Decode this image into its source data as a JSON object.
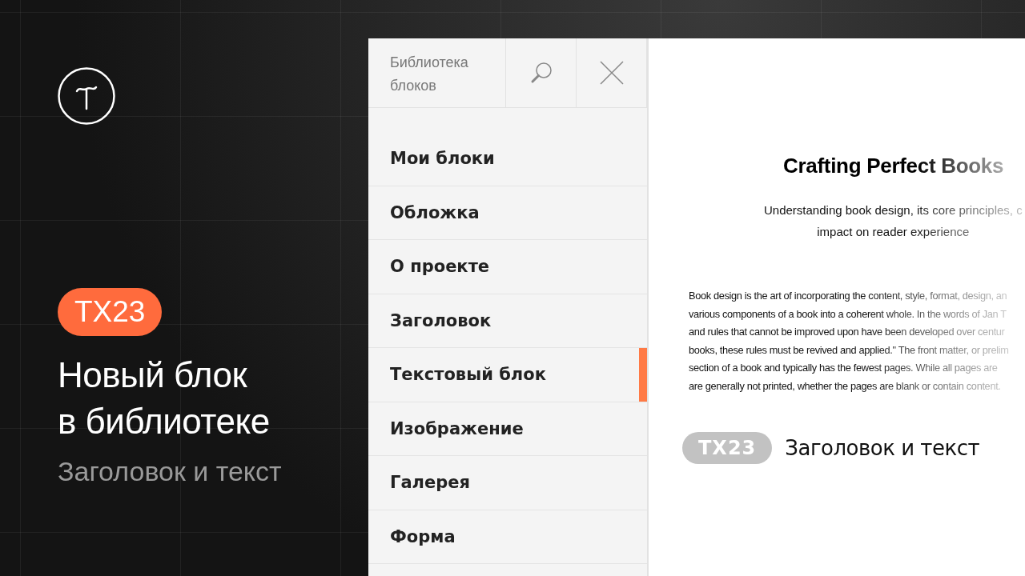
{
  "promo": {
    "badge": "TX23",
    "title_lines": [
      "Новый блок",
      "в библиотеке"
    ],
    "subtitle": "Заголовок и текст"
  },
  "library": {
    "title": "Библиотека блоков",
    "categories": [
      {
        "label": "Мои блоки",
        "selected": false
      },
      {
        "label": "Обложка",
        "selected": false
      },
      {
        "label": "О проекте",
        "selected": false
      },
      {
        "label": "Заголовок",
        "selected": false
      },
      {
        "label": "Текстовый блок",
        "selected": true
      },
      {
        "label": "Изображение",
        "selected": false
      },
      {
        "label": "Галерея",
        "selected": false
      },
      {
        "label": "Форма",
        "selected": false
      }
    ]
  },
  "preview": {
    "heading": "Crafting Perfect Books",
    "lead_lines": [
      "Understanding book design, its core principles, c",
      "impact on reader experience"
    ],
    "body_lines": [
      "Book design is the art of incorporating the content, style, format, design, an",
      "various components of a book into a coherent whole. In the words of Jan T",
      "and rules that cannot be improved upon have been developed over centur",
      "books, these rules must be revived and applied.\" The front matter, or prelim",
      "section of a book and typically has the fewest pages. While all pages are",
      "are generally not printed, whether the pages are blank or contain content."
    ],
    "block_code": "TX23",
    "block_name": "Заголовок и текст"
  }
}
